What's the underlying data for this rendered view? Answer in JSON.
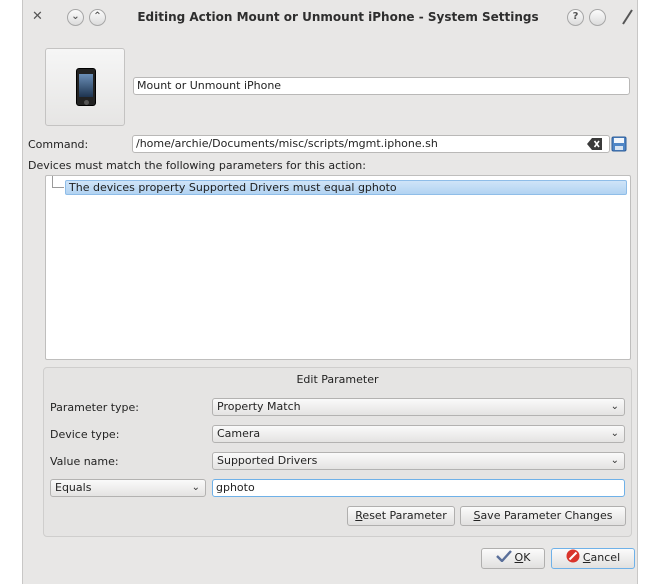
{
  "window": {
    "title": "Editing Action Mount or Unmount iPhone - System Settings",
    "close_glyph": "✕",
    "minimize_glyph": "⌄",
    "maximize_glyph": "⌃",
    "help_glyph": "?"
  },
  "action": {
    "icon": "iphone-icon",
    "name": "Mount or Unmount iPhone"
  },
  "command": {
    "label": "Command:",
    "value": "/home/archie/Documents/misc/scripts/mgmt.iphone.sh"
  },
  "devices_label": "Devices must match the following parameters for this action:",
  "parameters": [
    {
      "text": "The devices property Supported Drivers must equal gphoto",
      "selected": true
    }
  ],
  "edit_parameter": {
    "title": "Edit Parameter",
    "parameter_type_label": "Parameter type:",
    "parameter_type_value": "Property Match",
    "device_type_label": "Device type:",
    "device_type_value": "Camera",
    "value_name_label": "Value name:",
    "value_name_value": "Supported Drivers",
    "comparison_value": "Equals",
    "match_value": "gphoto",
    "reset_button_mnemonic": "R",
    "reset_button_rest": "eset Parameter",
    "save_button_mnemonic": "S",
    "save_button_rest": "ave Parameter Changes"
  },
  "buttons": {
    "ok_mnemonic": "O",
    "ok_rest": "K",
    "cancel_mnemonic": "C",
    "cancel_rest": "ancel"
  },
  "colors": {
    "window_bg": "#e8e7e6",
    "selection": "#b2d3f2",
    "focus_border": "#6fb1e8",
    "cancel_icon": "#d9342b",
    "ok_icon": "#5a6f9a"
  }
}
